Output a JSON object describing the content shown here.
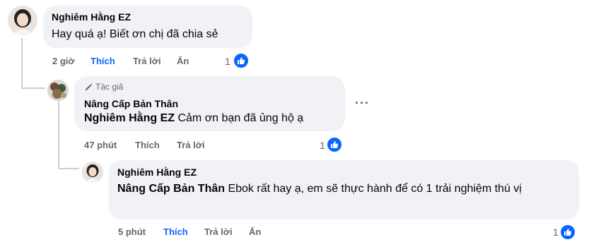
{
  "comments": [
    {
      "author": "Nghiêm Hằng EZ",
      "text": "Hay quá ạ! Biết ơn chị đã chia sẻ",
      "time": "2 giờ",
      "like_label": "Thích",
      "reply_label": "Trả lời",
      "hide_label": "Ẩn",
      "reactions": "1"
    },
    {
      "author_badge": "Tác giả",
      "author": "Nâng Cấp Bản Thân",
      "mention": "Nghiêm Hằng EZ",
      "text": " Cảm ơn bạn đã ủng hộ ạ",
      "time": "47 phút",
      "like_label": "Thích",
      "reply_label": "Trả lời",
      "reactions": "1",
      "more_label": "···"
    },
    {
      "author": "Nghiêm Hằng EZ",
      "mention": "Nâng Cấp Bản Thân",
      "text": " Ebok rất hay ạ, em sẽ thực hành để có 1 trải nghiệm thú vị",
      "time": "5 phút",
      "like_label": "Thích",
      "reply_label": "Trả lời",
      "hide_label": "Ẩn",
      "reactions": "1"
    }
  ],
  "icons": {
    "like": "thumbs-up-icon",
    "author_badge": "pencil-icon",
    "more": "more-icon"
  },
  "colors": {
    "bubble": "#f0f2f5",
    "like_active": "#0866ff",
    "secondary_text": "#65676b",
    "thread_line": "#ccd0d5"
  }
}
